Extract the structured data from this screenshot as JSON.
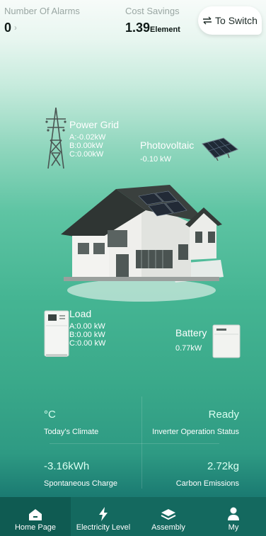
{
  "header": {
    "alarms_label": "Number Of Alarms",
    "alarms_value": "0",
    "savings_label": "Cost Savings",
    "savings_value": "1.39",
    "savings_unit": "Element",
    "switch_label": "To Switch",
    "switch_icon": "swap-arrows-icon"
  },
  "power_grid": {
    "title": "Power Grid",
    "a": "A:-0.02kW",
    "b": "B:0.00kW",
    "c": "C:0.00kW",
    "icon": "transmission-tower-icon"
  },
  "photovoltaic": {
    "title": "Photovoltaic",
    "value": "-0.10 kW",
    "icon": "solar-panel-icon"
  },
  "load": {
    "title": "Load",
    "a": "A:0.00 kW",
    "b": "B:0.00 kW",
    "c": "C:0.00 kW",
    "icon": "load-cabinet-icon"
  },
  "battery": {
    "title": "Battery",
    "value": "0.77kW",
    "icon": "battery-unit-icon"
  },
  "metrics": {
    "climate_value": "°C",
    "climate_label": "Today's Climate",
    "inverter_value": "Ready",
    "inverter_label": "Inverter Operation Status",
    "charge_value": "-3.16kWh",
    "charge_label": "Spontaneous Charge",
    "carbon_value": "2.72kg",
    "carbon_label": "Carbon Emissions"
  },
  "nav": {
    "home": "Home Page",
    "electricity": "Electricity Level",
    "assembly": "Assembly",
    "my": "My"
  },
  "colors": {
    "accent": "#14695f",
    "nav_active": "#0f5b52"
  }
}
